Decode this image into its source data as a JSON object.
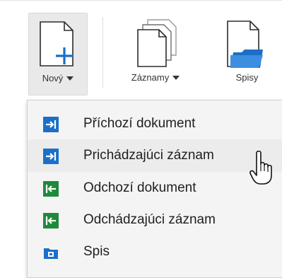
{
  "toolbar": {
    "novy_label": "Nový",
    "zaznamy_label": "Záznamy",
    "spisy_label": "Spisy"
  },
  "menu": {
    "items": [
      {
        "label": "Příchozí dokument",
        "icon": "incoming-arrow-icon",
        "color": "#1b6fc9"
      },
      {
        "label": "Prichádzajúci záznam",
        "icon": "incoming-arrow-icon",
        "color": "#1b6fc9"
      },
      {
        "label": "Odchozí dokument",
        "icon": "outgoing-arrow-icon",
        "color": "#1e8a3b"
      },
      {
        "label": "Odchádzajúci záznam",
        "icon": "outgoing-arrow-icon",
        "color": "#1e8a3b"
      },
      {
        "label": "Spis",
        "icon": "folder-icon",
        "color": "#1b6fc9"
      }
    ]
  },
  "cursor": "hand-pointer-icon"
}
